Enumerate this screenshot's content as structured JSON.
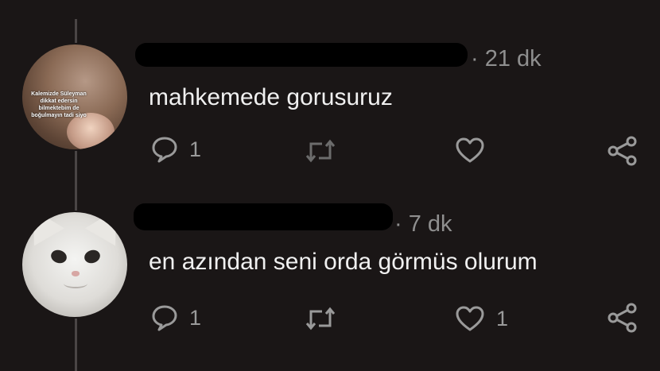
{
  "tweets": [
    {
      "avatar_caption": "Kalemizde Süleyman dikkat edersin bilmektebim de boğulmayın tadi siyo",
      "time": "· 21 dk",
      "text": "mahkemede gorusuruz",
      "reply_count": "1",
      "retweet_count": "",
      "like_count": ""
    },
    {
      "time": "· 7 dk",
      "text": "en azından seni orda görmüs olurum",
      "reply_count": "1",
      "retweet_count": "",
      "like_count": "1"
    }
  ],
  "colors": {
    "background": "#1a1616",
    "text": "#f0f0f0",
    "muted": "#8f8f8f",
    "icon": "#9a9a9a"
  },
  "icons": [
    "reply-icon",
    "retweet-icon",
    "like-icon",
    "share-icon"
  ]
}
